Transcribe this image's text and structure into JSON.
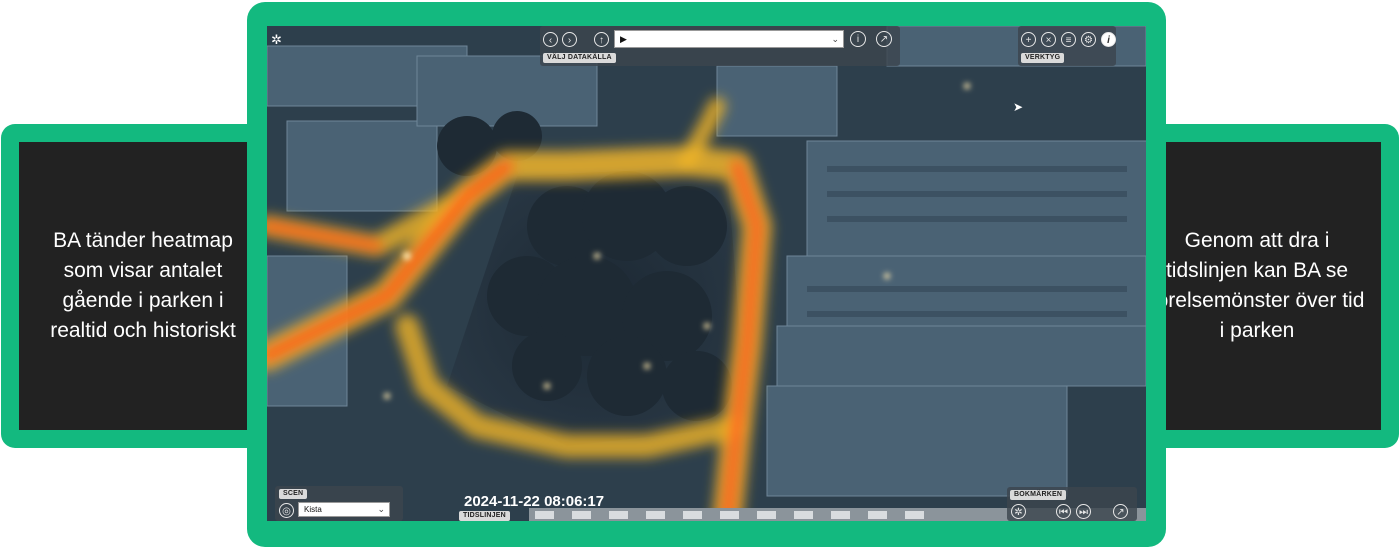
{
  "left_card": {
    "text": "BA tänder heatmap som visar antalet gående i parken i realtid och historiskt"
  },
  "right_card": {
    "text": "Genom att dra i tidslinjen kan BA se rörelsemönster över tid i parken"
  },
  "top_toolbar": {
    "back_icon": "arrow-left-icon",
    "forward_icon": "arrow-right-icon",
    "up_icon": "arrow-up-icon",
    "datasource_value": "▶",
    "datasource_tag": "VÄLJ DATAKÄLLA",
    "info_icon": "info-icon",
    "compass_icon": "compass-icon"
  },
  "tools": {
    "tag": "VERKTYG",
    "icons": [
      "zoom-in-icon",
      "measure-icon",
      "chart-icon",
      "settings-icon",
      "info-icon"
    ]
  },
  "scene": {
    "tag": "SCEN",
    "select_value": "Kista"
  },
  "timeline": {
    "timestamp": "2024-11-22 08:06:17",
    "tag": "TIDSLINJEN",
    "segments": 11
  },
  "bookmarks": {
    "tag": "BOKMÄRKEN",
    "icons": [
      "bookmark-star-icon",
      "previous-icon",
      "next-icon",
      "share-icon"
    ]
  },
  "colors": {
    "frame": "#13b97f",
    "card_bg": "#222222",
    "heat_core": "#ff5a1e",
    "heat_edge": "#f0b428"
  }
}
